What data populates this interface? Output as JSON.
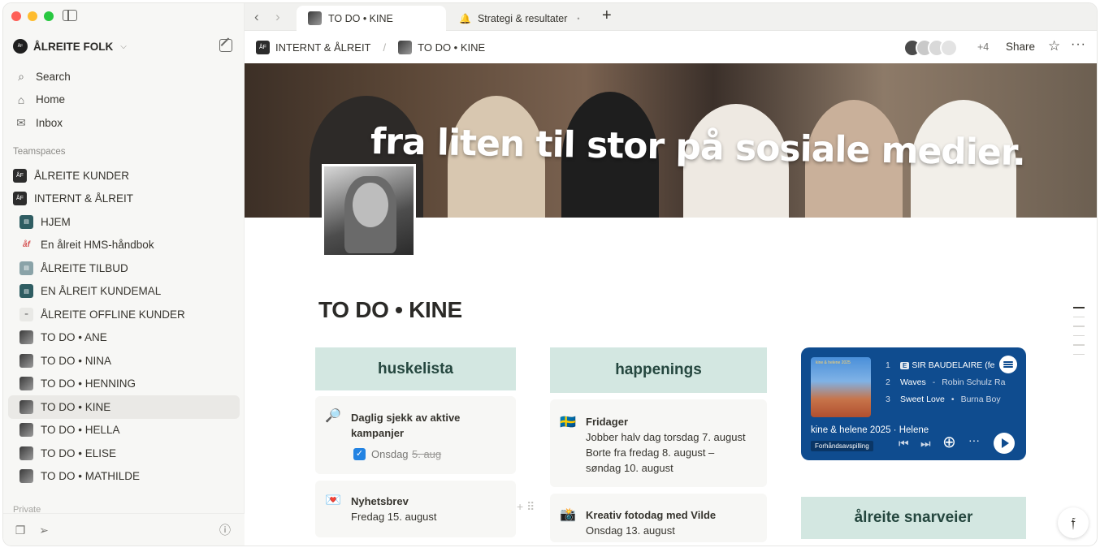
{
  "sidebar": {
    "workspace_name": "ÅLREITE FOLK",
    "nav": [
      {
        "label": "Search",
        "icon": "search-icon"
      },
      {
        "label": "Home",
        "icon": "home-icon"
      },
      {
        "label": "Inbox",
        "icon": "inbox-icon"
      }
    ],
    "section_label": "Teamspaces",
    "pages": [
      {
        "label": "ÅLREITE KUNDER",
        "icon_style": "dark"
      },
      {
        "label": "INTERNT & ÅLREIT",
        "icon_style": "dark"
      },
      {
        "label": "HJEM",
        "icon_style": "teal"
      },
      {
        "label": "En ålreit HMS-håndbok",
        "icon_style": "red"
      },
      {
        "label": "ÅLREITE TILBUD",
        "icon_style": "gray"
      },
      {
        "label": "EN ÅLREIT KUNDEMAL",
        "icon_style": "teal"
      },
      {
        "label": "ÅLREITE OFFLINE KUNDER",
        "icon_style": "light"
      },
      {
        "label": "TO DO • ANE",
        "icon_style": "photo"
      },
      {
        "label": "TO DO • NINA",
        "icon_style": "photo"
      },
      {
        "label": "TO DO • HENNING",
        "icon_style": "photo"
      },
      {
        "label": "TO DO • KINE",
        "icon_style": "photo",
        "active": true
      },
      {
        "label": "TO DO • HELLA",
        "icon_style": "photo"
      },
      {
        "label": "TO DO • ELISE",
        "icon_style": "photo"
      },
      {
        "label": "TO DO • MATHILDE",
        "icon_style": "photo"
      }
    ],
    "private_label": "Private"
  },
  "tabs": [
    {
      "label": "TO DO • KINE",
      "active": true
    },
    {
      "label": "Strategi & resultater",
      "active": false
    }
  ],
  "topbar": {
    "crumb_parent": "INTERNT & ÅLREIT",
    "crumb_current": "TO DO • KINE",
    "extra_collaborators": "+4",
    "share_label": "Share"
  },
  "cover_text": "fra liten til stor på sosiale medier.",
  "page": {
    "title": "TO DO • KINE",
    "columns": [
      {
        "heading": "huskelista"
      },
      {
        "heading": "happenings"
      },
      {
        "heading": "ålreite snarveier"
      }
    ],
    "huskelista_cards": [
      {
        "icon": "🔎",
        "title_line1": "Daglig sjekk av aktive",
        "title_line2": "kampanjer",
        "date_prefix": "Onsdag",
        "date_struck": "5. aug",
        "checked": true
      },
      {
        "icon": "💌",
        "title": "Nyhetsbrev",
        "date": "Fredag 15. august"
      }
    ],
    "happenings_cards": [
      {
        "icon": "🇸🇪",
        "title": "Fridager",
        "lines": [
          "Jobber halv dag torsdag 7. august",
          "Borte fra fredag 8. august –",
          "søndag 10. august"
        ]
      },
      {
        "icon": "📸",
        "title": "Kreativ fotodag med Vilde",
        "date": "Onsdag 13. august"
      }
    ]
  },
  "spotify": {
    "cover_label": "kine & helene 2025",
    "tracks": [
      {
        "num": "1",
        "explicit": true,
        "title": "SIR BAUDELAIRE (fe",
        "artist": ""
      },
      {
        "num": "2",
        "explicit": false,
        "title": "Waves",
        "artist": "Robin Schulz Ra"
      },
      {
        "num": "3",
        "explicit": false,
        "title": "Sweet Love",
        "artist": "Burna Boy"
      }
    ],
    "playlist_title": "kine & helene 2025 · Helene",
    "preview_badge": "Forhåndsavspilling"
  },
  "colors": {
    "column_heading_bg": "#d3e7e1",
    "spotify_bg": "#0f4c8f",
    "checkbox": "#2383e2"
  }
}
